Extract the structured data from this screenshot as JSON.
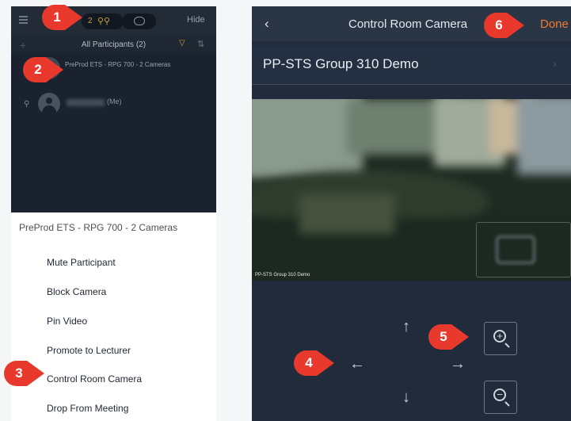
{
  "left_screen": {
    "hide_label": "Hide",
    "participant_count": "2",
    "participants_header": "All Participants (2)",
    "participant_1": "PreProd ETS - RPG 700 - 2 Cameras",
    "participant_2_suffix": "(Me)",
    "sheet_title": "PreProd ETS - RPG 700 - 2 Cameras",
    "sheet_items": [
      "Mute Participant",
      "Block Camera",
      "Pin Video",
      "Promote to Lecturer",
      "Control Room Camera",
      "Drop From Meeting"
    ]
  },
  "right_screen": {
    "title": "Control Room Camera",
    "done_label": "Done",
    "room_name": "PP-STS Group 310 Demo",
    "video_caption": "PP-STS Group 310 Demo",
    "back_glyph": "‹",
    "chevron_glyph": "›",
    "arrows": {
      "up": "↑",
      "down": "↓",
      "left": "←",
      "right": "→"
    },
    "zoom_in_glyph": "+",
    "zoom_out_glyph": "−"
  },
  "callouts": [
    "1",
    "2",
    "3",
    "4",
    "5",
    "6"
  ],
  "colors": {
    "callout_red": "#e8392c",
    "accent_orange": "#f07b2a",
    "participant_gold": "#c9a23b",
    "dark_bg": "#212b3b"
  }
}
